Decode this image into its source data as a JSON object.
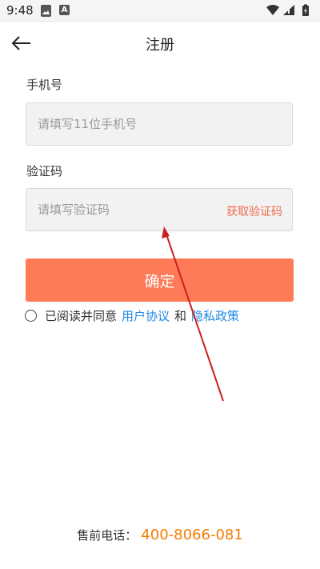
{
  "status_bar": {
    "time": "9:48",
    "icons": [
      "gallery-icon",
      "font-icon",
      "wifi-icon",
      "signal-icon",
      "battery-icon"
    ]
  },
  "header": {
    "title": "注册",
    "back_icon": "arrow-left-icon"
  },
  "form": {
    "phone_label": "手机号",
    "phone_placeholder": "请填写11位手机号",
    "phone_value": "",
    "code_label": "验证码",
    "code_placeholder": "请填写验证码",
    "code_value": "",
    "get_code_label": "获取验证码",
    "confirm_label": "确定"
  },
  "agreement": {
    "checked": false,
    "prefix": "已阅读并同意",
    "user_agreement": "用户协议",
    "conjunction": "和",
    "privacy_policy": "隐私政策"
  },
  "footer": {
    "label": "售前电话：",
    "phone": "400-8066-081"
  },
  "colors": {
    "accent": "#ff7a57",
    "link": "#1e88e5",
    "get_code": "#f26a4b",
    "footer_phone": "#f57c00",
    "annotation_arrow": "#cc1f1f"
  }
}
